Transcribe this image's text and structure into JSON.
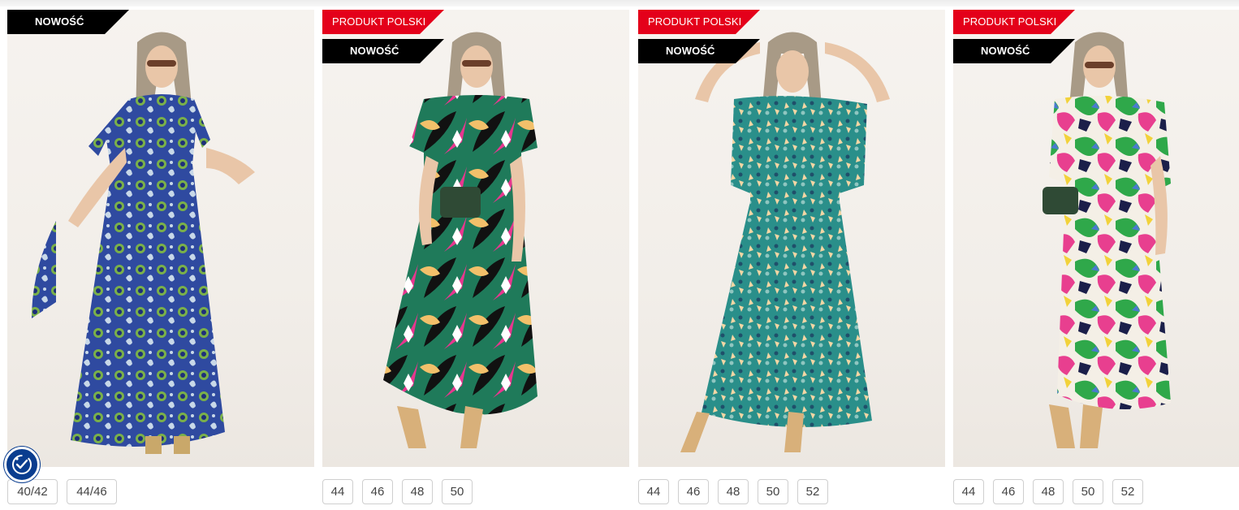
{
  "products": [
    {
      "badges": [
        {
          "type": "new",
          "label": "NOWOŚĆ"
        }
      ],
      "dress_colors": {
        "base": "#2f4aa0",
        "accent1": "#7ab04a",
        "accent2": "#1e2f7a",
        "accent3": "#c8d8e8"
      },
      "image_icon": "model-in-paisley-maxi-dress",
      "sizes": [
        "40/42",
        "44/46"
      ]
    },
    {
      "badges": [
        {
          "type": "pl",
          "label": "PRODUKT POLSKI"
        },
        {
          "type": "new",
          "label": "NOWOŚĆ"
        }
      ],
      "dress_colors": {
        "base": "#1f7a5a",
        "accent1": "#e8368f",
        "accent2": "#f2c06a",
        "accent3": "#111111"
      },
      "image_icon": "model-in-tropical-leaf-dress",
      "sizes": [
        "44",
        "46",
        "48",
        "50"
      ]
    },
    {
      "badges": [
        {
          "type": "pl",
          "label": "PRODUKT POLSKI"
        },
        {
          "type": "new",
          "label": "NOWOŚĆ"
        }
      ],
      "dress_colors": {
        "base": "#2a8f8a",
        "accent1": "#f3d6a4",
        "accent2": "#1f4f6a",
        "accent3": "#8fc6c0"
      },
      "image_icon": "model-in-floral-maxi-dress",
      "sizes": [
        "44",
        "46",
        "48",
        "50",
        "52"
      ]
    },
    {
      "badges": [
        {
          "type": "pl",
          "label": "PRODUKT POLSKI"
        },
        {
          "type": "new",
          "label": "NOWOŚĆ"
        }
      ],
      "dress_colors": {
        "base": "#f4efe6",
        "accent1": "#2fa84a",
        "accent2": "#e83f8f",
        "accent3": "#1b1f4a"
      },
      "image_icon": "model-in-abstract-print-dress",
      "sizes": [
        "44",
        "46",
        "48",
        "50",
        "52"
      ]
    }
  ],
  "accessibility_widget": {
    "icon": "accessibility-icon",
    "color": "#0a3d8f"
  }
}
